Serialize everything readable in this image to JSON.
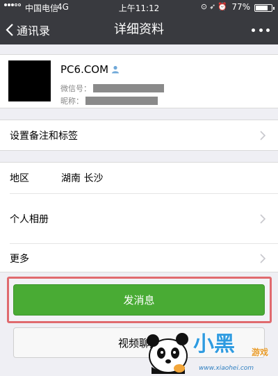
{
  "status_bar": {
    "carrier": "中国电信",
    "network": "4G",
    "time": "上午11:12",
    "battery_percent": "77%",
    "battery_level": 0.77
  },
  "nav": {
    "back_label": "通讯录",
    "title": "详细资料"
  },
  "profile": {
    "name": "PC6.COM",
    "wechat_id_label": "微信号：",
    "nickname_label": "昵称："
  },
  "cells": {
    "remark_tags": "设置备注和标签",
    "region_label": "地区",
    "region_value": "湖南 长沙",
    "album": "个人相册",
    "more": "更多"
  },
  "actions": {
    "send_message": "发消息",
    "video_call": "视频聊天"
  },
  "watermark": {
    "brand": "小黑",
    "sub": "游戏",
    "url": "www.xiaohei.com"
  },
  "colors": {
    "navbar": "#393a3f",
    "primary_button": "#49ab34",
    "highlight_border": "#e06a6e",
    "page_background": "#efeff4"
  }
}
